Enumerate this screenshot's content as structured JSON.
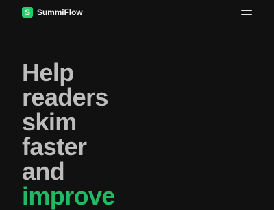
{
  "colors": {
    "background": "#111111",
    "brand_green": "#1fd06a",
    "heading_text": "#bdbdbd",
    "accent_text": "#22b864"
  },
  "header": {
    "logo_letter": "S",
    "logo_icon": "brand-logo-s",
    "brand_name": "SummiFlow",
    "menu_icon": "hamburger-menu-icon"
  },
  "hero": {
    "lines": [
      "Help",
      "readers",
      "skim",
      "faster",
      "and"
    ],
    "accent_line": "improve"
  }
}
